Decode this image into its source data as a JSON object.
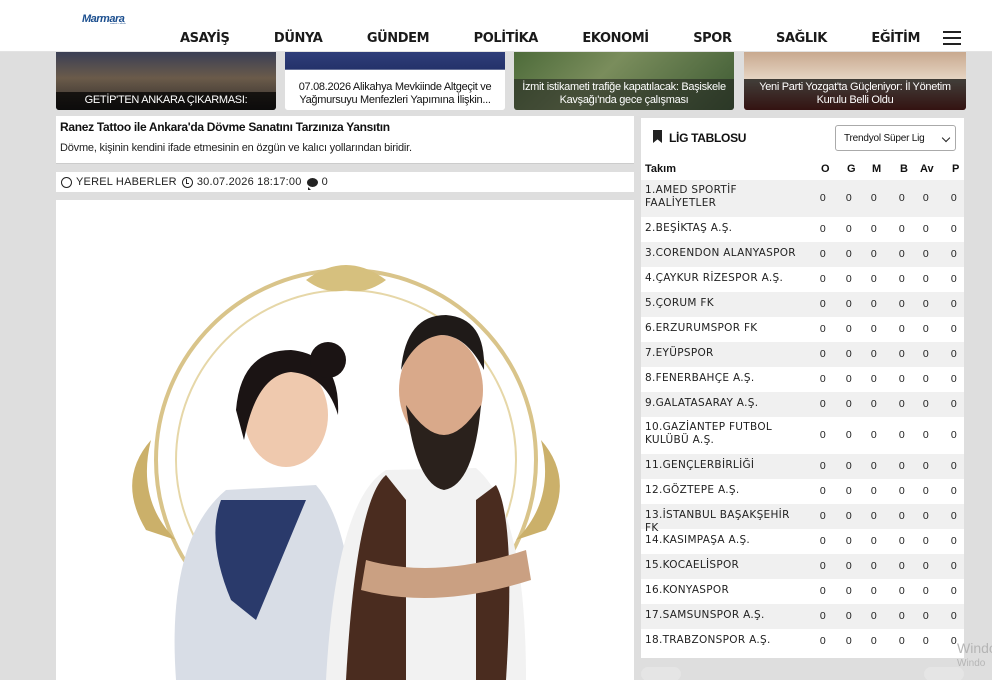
{
  "logo": {
    "main": "Marmara",
    "sub": "yeni ufuk"
  },
  "nav": [
    "ASAYİŞ",
    "DÜNYA",
    "GÜNDEM",
    "POLİTİKA",
    "EKONOMİ",
    "SPOR",
    "SAĞLIK",
    "EĞİTİM"
  ],
  "news_strip": [
    "GETİP'TEN ANKARA ÇIKARMASI:",
    "07.08.2026 Alikahya Mevkiinde Altgeçit ve Yağmursuyu Menfezleri Yapımına İlişkin...",
    "İzmit istikameti trafiğe kapatılacak: Başiskele Kavşağı'nda gece çalışması",
    "Yeni Parti Yozgat'ta Güçleniyor: İl Yönetim Kurulu Belli Oldu"
  ],
  "article": {
    "title": "Ranez Tattoo ile Ankara'da Dövme Sanatını Tarzınıza Yansıtın",
    "description": "Dövme, kişinin kendini ifade etmesinin en özgün ve kalıcı yollarından biridir.",
    "category": "YEREL HABERLER",
    "datetime": "30.07.2026 18:17:00",
    "comments": "0"
  },
  "league": {
    "title": "LİG TABLOSU",
    "selected": "Trendyol Süper Lig",
    "columns": [
      "Takım",
      "O",
      "G",
      "M",
      "B",
      "Av",
      "P"
    ],
    "teams": [
      {
        "name": "1.AMED SPORTİF FAALİYETLER",
        "o": "0",
        "g": "0",
        "m": "0",
        "b": "0",
        "av": "0",
        "p": "0"
      },
      {
        "name": "2.BEŞİKTAŞ A.Ş.",
        "o": "0",
        "g": "0",
        "m": "0",
        "b": "0",
        "av": "0",
        "p": "0"
      },
      {
        "name": "3.CORENDON ALANYASPOR",
        "o": "0",
        "g": "0",
        "m": "0",
        "b": "0",
        "av": "0",
        "p": "0"
      },
      {
        "name": "4.ÇAYKUR RİZESPOR A.Ş.",
        "o": "0",
        "g": "0",
        "m": "0",
        "b": "0",
        "av": "0",
        "p": "0"
      },
      {
        "name": "5.ÇORUM FK",
        "o": "0",
        "g": "0",
        "m": "0",
        "b": "0",
        "av": "0",
        "p": "0"
      },
      {
        "name": "6.ERZURUMSPOR FK",
        "o": "0",
        "g": "0",
        "m": "0",
        "b": "0",
        "av": "0",
        "p": "0"
      },
      {
        "name": "7.EYÜPSPOR",
        "o": "0",
        "g": "0",
        "m": "0",
        "b": "0",
        "av": "0",
        "p": "0"
      },
      {
        "name": "8.FENERBAHÇE A.Ş.",
        "o": "0",
        "g": "0",
        "m": "0",
        "b": "0",
        "av": "0",
        "p": "0"
      },
      {
        "name": "9.GALATASARAY A.Ş.",
        "o": "0",
        "g": "0",
        "m": "0",
        "b": "0",
        "av": "0",
        "p": "0"
      },
      {
        "name": "10.GAZİANTEP FUTBOL KULÜBÜ A.Ş.",
        "o": "0",
        "g": "0",
        "m": "0",
        "b": "0",
        "av": "0",
        "p": "0"
      },
      {
        "name": "11.GENÇLERBİRLİĞİ",
        "o": "0",
        "g": "0",
        "m": "0",
        "b": "0",
        "av": "0",
        "p": "0"
      },
      {
        "name": "12.GÖZTEPE A.Ş.",
        "o": "0",
        "g": "0",
        "m": "0",
        "b": "0",
        "av": "0",
        "p": "0"
      },
      {
        "name": "13.İSTANBUL BAŞAKŞEHİR FK",
        "o": "0",
        "g": "0",
        "m": "0",
        "b": "0",
        "av": "0",
        "p": "0"
      },
      {
        "name": "14.KASIMPAŞA A.Ş.",
        "o": "0",
        "g": "0",
        "m": "0",
        "b": "0",
        "av": "0",
        "p": "0"
      },
      {
        "name": "15.KOCAELİSPOR",
        "o": "0",
        "g": "0",
        "m": "0",
        "b": "0",
        "av": "0",
        "p": "0"
      },
      {
        "name": "16.KONYASPOR",
        "o": "0",
        "g": "0",
        "m": "0",
        "b": "0",
        "av": "0",
        "p": "0"
      },
      {
        "name": "17.SAMSUNSPOR A.Ş.",
        "o": "0",
        "g": "0",
        "m": "0",
        "b": "0",
        "av": "0",
        "p": "0"
      },
      {
        "name": "18.TRABZONSPOR A.Ş.",
        "o": "0",
        "g": "0",
        "m": "0",
        "b": "0",
        "av": "0",
        "p": "0"
      }
    ]
  },
  "watermark": {
    "line1": "Windo",
    "line2": "Windo"
  }
}
